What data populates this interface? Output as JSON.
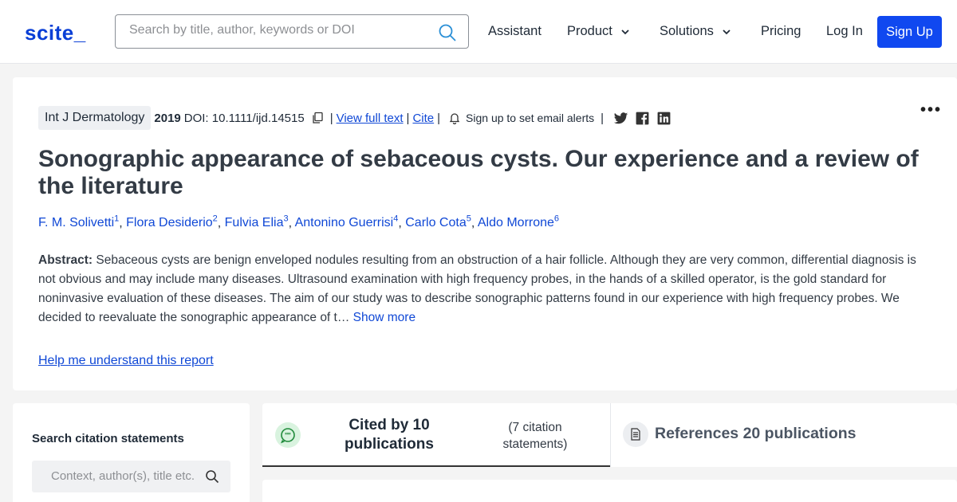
{
  "header": {
    "logo": "scite_",
    "search_placeholder": "Search by title, author, keywords or DOI",
    "nav": {
      "assistant": "Assistant",
      "product": "Product",
      "solutions": "Solutions",
      "pricing": "Pricing",
      "login": "Log In",
      "signup": "Sign Up"
    }
  },
  "paper": {
    "journal": "Int J Dermatology",
    "year": "2019",
    "doi": "DOI: 10.1111/ijd.14515",
    "view_full_text": "View full text",
    "cite": "Cite",
    "alerts": "Sign up to set email alerts",
    "title": "Sonographic appearance of sebaceous cysts. Our experience and a review of the literature",
    "authors": [
      {
        "name": "F. M. Solivetti",
        "sup": "1"
      },
      {
        "name": "Flora Desiderio",
        "sup": "2"
      },
      {
        "name": "Fulvia Elia",
        "sup": "3"
      },
      {
        "name": "Antonino Guerrisi",
        "sup": "4"
      },
      {
        "name": "Carlo Cota",
        "sup": "5"
      },
      {
        "name": "Aldo Morrone",
        "sup": "6"
      }
    ],
    "abstract_label": "Abstract:",
    "abstract_text": "Sebaceous cysts are benign enveloped nodules resulting from an obstruction of a hair follicle. Although they are very common, differential diagnosis is not obvious and may include many diseases. Ultrasound examination with high frequency probes, in the hands of a skilled operator, is the gold standard for noninvasive evaluation of these diseases. The aim of our study was to describe sonographic patterns found in our experience with high frequency probes. We decided to reevaluate the sonographic appearance of t…",
    "show_more": "Show more",
    "help_link": "Help me understand this report"
  },
  "citation_search": {
    "title": "Search citation statements",
    "placeholder": "Context, author(s), title etc."
  },
  "tabs": {
    "cited_by": "Cited by 10 publications",
    "cited_statements": "(7 citation statements)",
    "references": "References 20 publications"
  },
  "colors": {
    "brand": "#0a3fd6",
    "button": "#1048f0",
    "link": "#1048d6"
  }
}
